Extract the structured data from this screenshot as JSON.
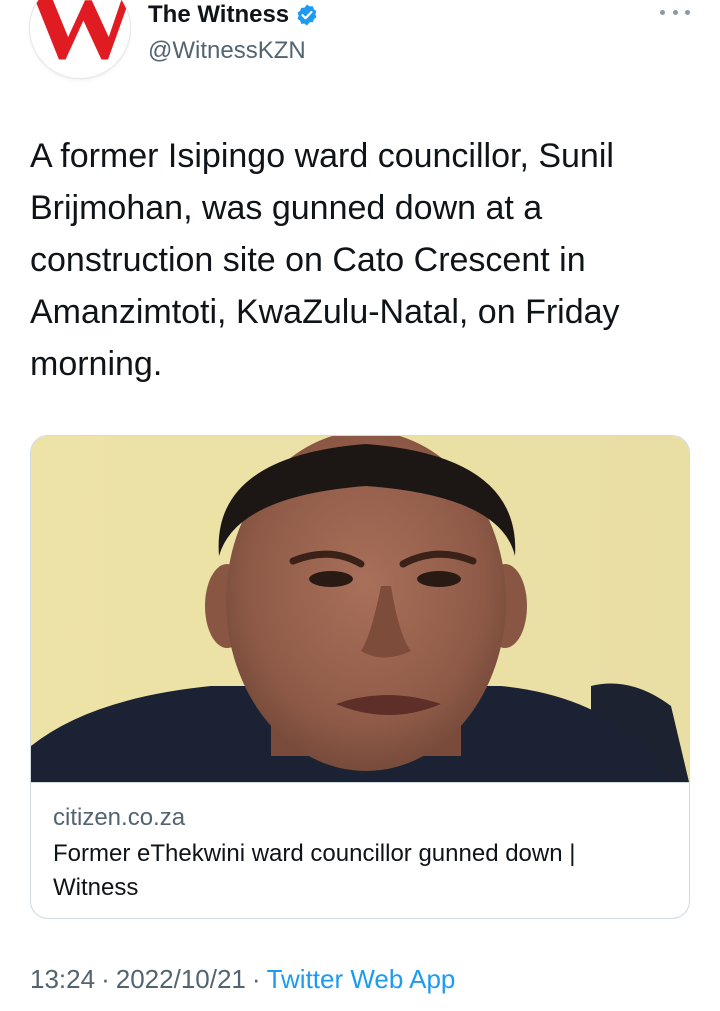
{
  "tweet": {
    "author": {
      "avatar_letter": "W",
      "display_name": "The Witness",
      "handle": "@WitnessKZN",
      "verified": true
    },
    "text": "A former Isipingo ward councillor, Sunil Brijmohan, was gunned down at a construction site on Cato Crescent in Amanzimtoti, KwaZulu-Natal, on Friday morning.",
    "card": {
      "domain": "citizen.co.za",
      "title": "Former eThekwini ward councillor gunned down | Witness"
    },
    "meta": {
      "time": "13:24",
      "separator": "·",
      "date": "2022/10/21",
      "source": "Twitter Web App"
    }
  },
  "colors": {
    "accent": "#1d9bf0",
    "brand_red": "#e01c22",
    "secondary_text": "#536471",
    "primary_text": "#0f1419"
  },
  "icons": {
    "verified": "verified-badge-icon",
    "more": "more-horizontal-icon"
  }
}
